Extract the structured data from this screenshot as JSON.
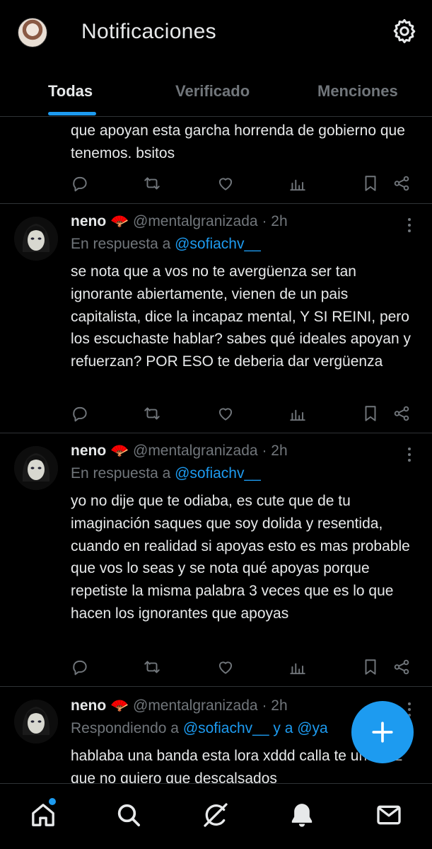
{
  "header": {
    "title": "Notificaciones"
  },
  "tabs": [
    {
      "label": "Todas"
    },
    {
      "label": "Verificado"
    },
    {
      "label": "Menciones"
    }
  ],
  "posts": [
    {
      "text": "que apoyan esta garcha horrenda de gobierno que tenemos. bsitos"
    },
    {
      "name": "neno 🪭",
      "handle": "@mentalgranizada",
      "time": "· 2h",
      "reply_prefix": "En respuesta a",
      "reply_to": "@sofiachv__",
      "text": "se nota que a vos no te avergüenza ser tan ignorante abiertamente, vienen de un pais capitalista, dice la incapaz mental, Y SI REINI, pero los escuchaste hablar? sabes qué ideales apoyan y refuerzan? POR ESO te deberia dar vergüenza"
    },
    {
      "name": "neno 🪭",
      "handle": "@mentalgranizada",
      "time": "· 2h",
      "reply_prefix": "En respuesta a",
      "reply_to": "@sofiachv__",
      "text": "yo no dije que te odiaba, es cute que de tu imaginación saques que soy dolida y resentida, cuando en realidad si apoyas esto es mas probable que vos lo seas y se nota qué apoyas porque repetiste la misma palabra 3 veces que es lo que hacen los ignorantes que apoyas"
    },
    {
      "name": "neno 🪭",
      "handle": "@mentalgranizada",
      "time": "· 2h",
      "reply_prefix": "Respondiendo a",
      "reply_to": "@sofiachv__ y a @ya",
      "text": "hablaba una banda esta lora xddd calla te una vez que no quiero que descalsados"
    }
  ],
  "icons": {
    "reply": "reply-icon",
    "retweet": "retweet-icon",
    "like": "heart-icon",
    "views": "views-icon",
    "bookmark": "bookmark-icon",
    "share": "share-icon"
  },
  "colors": {
    "accent": "#1d9bf0",
    "background": "#000000",
    "muted": "#71767b",
    "text": "#e7e9ea"
  }
}
